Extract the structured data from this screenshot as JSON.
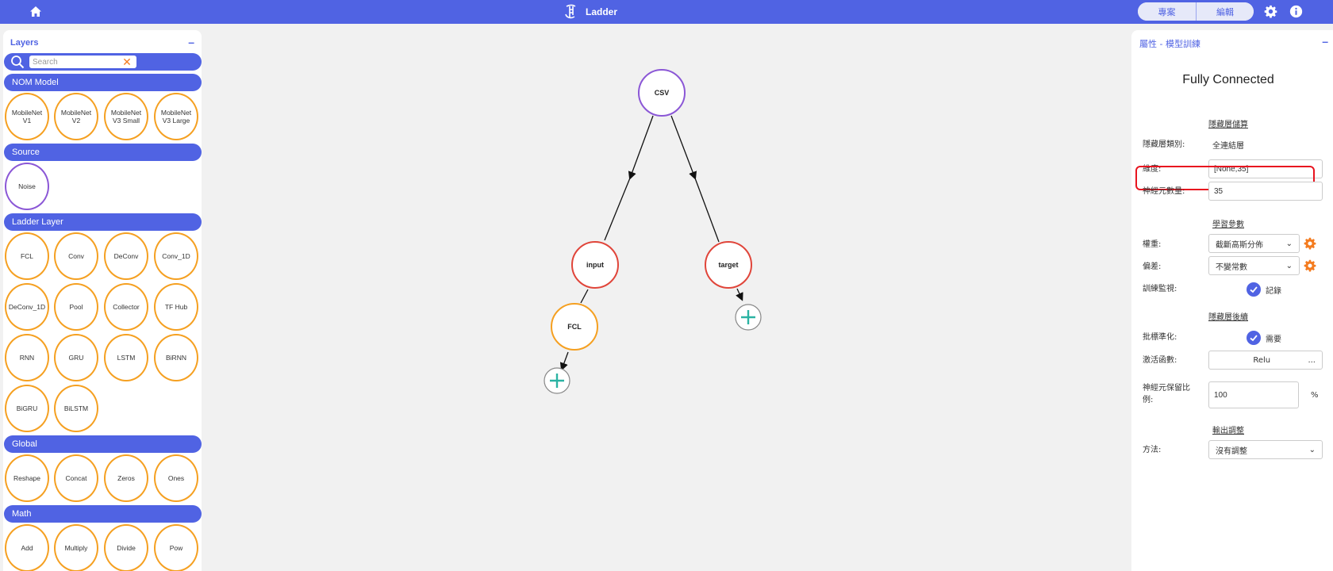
{
  "header": {
    "title": "Ladder",
    "project_label": "專案",
    "edit_label": "編輯"
  },
  "layers": {
    "title": "Layers",
    "search_placeholder": "Search",
    "categories": [
      {
        "name": "NOM Model",
        "items": [
          "MobileNet V1",
          "MobileNet V2",
          "MobileNet V3 Small",
          "MobileNet V3 Large"
        ]
      },
      {
        "name": "Source",
        "items": [
          "Noise"
        ]
      },
      {
        "name": "Ladder Layer",
        "items": [
          "FCL",
          "Conv",
          "DeConv",
          "Conv_1D",
          "DeConv_1D",
          "Pool",
          "Collector",
          "TF Hub",
          "RNN",
          "GRU",
          "LSTM",
          "BiRNN",
          "BiGRU",
          "BiLSTM"
        ]
      },
      {
        "name": "Global",
        "items": [
          "Reshape",
          "Concat",
          "Zeros",
          "Ones"
        ]
      },
      {
        "name": "Math",
        "items": [
          "Add",
          "Multiply",
          "Divide",
          "Pow"
        ]
      }
    ]
  },
  "graph": {
    "nodes": {
      "csv": "CSV",
      "input": "input",
      "target": "target",
      "fcl": "FCL"
    },
    "colors": {
      "source": "#8b57d6",
      "data": "#e0453a",
      "layer": "#f5a021",
      "add": "#2bb3a3"
    }
  },
  "properties": {
    "title": "屬性 - 模型訓練",
    "layer_name": "Fully Connected",
    "section_hidden": "隱藏層儲算",
    "section_learn": "學習參數",
    "section_post": "隱藏層後續",
    "section_output": "輸出調整",
    "layer_type_label": "隱藏層類別:",
    "layer_type_value": "全連結層",
    "dim_label": "維度:",
    "dim_value": "[None,35]",
    "neurons_label": "神經元數量:",
    "neurons_value": "35",
    "weight_label": "權重:",
    "weight_value": "截斷高斯分佈",
    "bias_label": "偏差:",
    "bias_value": "不變常數",
    "monitor_label": "訓練監視:",
    "monitor_value": "記錄",
    "batchnorm_label": "批標準化:",
    "batchnorm_value": "需要",
    "activation_label": "激活函數:",
    "activation_value": "Relu",
    "activation_more": "...",
    "dropout_label": "神經元保留比例:",
    "dropout_value": "100",
    "dropout_unit": "%",
    "method_label": "方法:",
    "method_value": "沒有調整"
  }
}
